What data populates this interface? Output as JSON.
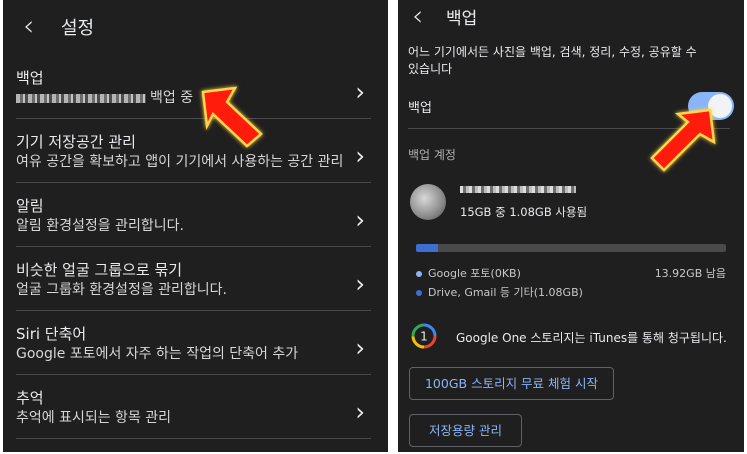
{
  "left": {
    "title": "설정",
    "items": [
      {
        "label": "백업",
        "sub": "백업 중"
      },
      {
        "label": "기기 저장공간 관리",
        "sub": "여유 공간을 확보하고 앱이 기기에서 사용하는 공간 관리"
      },
      {
        "label": "알림",
        "sub": "알림 환경설정을 관리합니다."
      },
      {
        "label": "비슷한 얼굴 그룹으로 묶기",
        "sub": "얼굴 그룹화 환경설정을 관리합니다."
      },
      {
        "label": "Siri 단축어",
        "sub": "Google 포토에서 자주 하는 작업의 단축어 추가"
      },
      {
        "label": "추억",
        "sub": "추억에 표시되는 항목 관리"
      }
    ]
  },
  "right": {
    "title": "백업",
    "description": "어느 기기에서든 사진을 백업, 검색, 정리, 수정, 공유할 수 있습니다",
    "backup_label": "백업",
    "backup_enabled": true,
    "account_section": "백업 계정",
    "usage_text": "15GB 중 1.08GB 사용됨",
    "usage_fraction": 0.072,
    "legend": [
      {
        "label": "Google 포토(0KB)",
        "color": "#8ab4f8"
      },
      {
        "label": "Drive, Gmail 등 기타(1.08GB)",
        "color": "#3c6fd1"
      }
    ],
    "remaining": "13.92GB 남음",
    "google_one_text": "Google One 스토리지는 iTunes를 통해 청구됩니다.",
    "trial_button": "100GB 스토리지 무료 체험 시작",
    "manage_button": "저장용량 관리"
  }
}
